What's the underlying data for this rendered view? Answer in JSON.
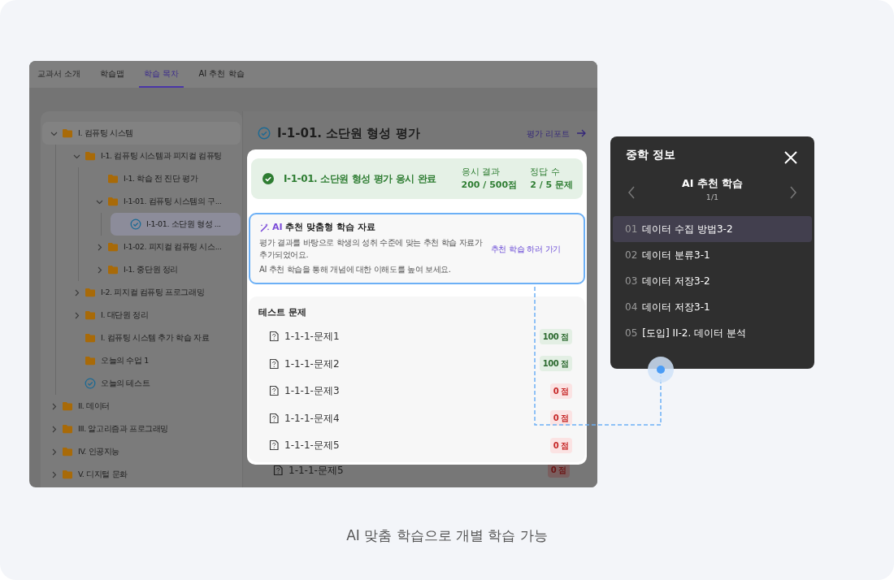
{
  "tabs": [
    {
      "label": "교과서 소개",
      "selected": false
    },
    {
      "label": "학습맵",
      "selected": false
    },
    {
      "label": "학습 목차",
      "selected": true
    },
    {
      "label": "AI 추천 학습",
      "selected": false
    }
  ],
  "tree": [
    {
      "label": "I. 컴퓨팅 시스템",
      "kind": "folder",
      "expanded": true,
      "selected": false,
      "children": [
        {
          "label": "I-1. 컴퓨팅 시스템과 피지컬 컴퓨팅",
          "kind": "folder",
          "expanded": true,
          "selected": false,
          "children": [
            {
              "label": "I-1. 학습 전 진단 평가",
              "kind": "folder",
              "selected": false
            },
            {
              "label": "I-1-01. 컴퓨팅 시스템의 구...",
              "kind": "folder",
              "expanded": true,
              "selected": false,
              "children": [
                {
                  "label": "I-1-01. 소단원 형성 ...",
                  "kind": "test",
                  "selected": true
                }
              ]
            },
            {
              "label": "I-1-02. 피지컬 컴퓨팅 시스...",
              "kind": "folder",
              "expanded": false,
              "selected": false
            },
            {
              "label": "I-1. 중단원 정리",
              "kind": "folder",
              "expanded": false,
              "selected": false
            }
          ]
        },
        {
          "label": "I-2. 피지컬 컴퓨팅 프로그래밍",
          "kind": "folder",
          "expanded": false,
          "selected": false
        },
        {
          "label": "I. 대단원 정리",
          "kind": "folder",
          "expanded": false,
          "selected": false
        },
        {
          "label": "I. 컴퓨팅 시스템 추가 학습 자료",
          "kind": "folder",
          "selected": false
        },
        {
          "label": "오늘의 수업 1",
          "kind": "folder",
          "selected": false
        },
        {
          "label": "오늘의 테스트",
          "kind": "test",
          "selected": false
        }
      ]
    },
    {
      "label": "II. 데이터",
      "kind": "folder",
      "expanded": false,
      "selected": false
    },
    {
      "label": "III. 알고리즘과 프로그래밍",
      "kind": "folder",
      "expanded": false,
      "selected": false
    },
    {
      "label": "IV. 인공지능",
      "kind": "folder",
      "expanded": false,
      "selected": false
    },
    {
      "label": "V. 디지털 문화",
      "kind": "folder",
      "expanded": false,
      "selected": false
    }
  ],
  "main": {
    "title": "I-1-01. 소단원 형성 평가",
    "report_link": "평가 리포트",
    "background_row": {
      "label": "1-1-1-문제5",
      "score": "0 점",
      "correct": false
    }
  },
  "popup": {
    "result": {
      "title": "I-1-01. 소단원 형성 평가 응시 완료",
      "score_label": "응시 결과",
      "score": "200 / 500점",
      "correct_label": "정답 수",
      "correct": "2 / 5 문제"
    },
    "ai_box": {
      "tag": "AI",
      "title": "추천 맞춤형 학습 자료",
      "description": "평가 결과를 바탕으로 학생의 성취 수준에 맞는 추천 학습 자료가 추가되었어요.",
      "note": "AI 추천 학습을 통해 개념에 대한 이해도를 높여 보세요.",
      "link": "추천 학습 하러 가기"
    },
    "questions": {
      "heading": "테스트 문제",
      "items": [
        {
          "label": "1-1-1-문제1",
          "score": "100 점",
          "correct": true
        },
        {
          "label": "1-1-1-문제2",
          "score": "100 점",
          "correct": true
        },
        {
          "label": "1-1-1-문제3",
          "score": "0 점",
          "correct": false
        },
        {
          "label": "1-1-1-문제4",
          "score": "0 점",
          "correct": false
        },
        {
          "label": "1-1-1-문제5",
          "score": "0 점",
          "correct": false
        }
      ]
    }
  },
  "side_panel": {
    "title": "중학 정보",
    "subtitle": "AI 추천 학습",
    "page": "1/1",
    "items": [
      {
        "number": "01",
        "label": "데이터 수집 방법3-2",
        "selected": true
      },
      {
        "number": "02",
        "label": "데이터 분류3-1",
        "selected": false
      },
      {
        "number": "03",
        "label": "데이터 저장3-2",
        "selected": false
      },
      {
        "number": "04",
        "label": "데이터 저장3-1",
        "selected": false
      },
      {
        "number": "05",
        "label": "[도입] II-2. 데이터 분석",
        "selected": false
      }
    ]
  },
  "caption": "AI 맞춤 학습으로 개별 학습 가능"
}
